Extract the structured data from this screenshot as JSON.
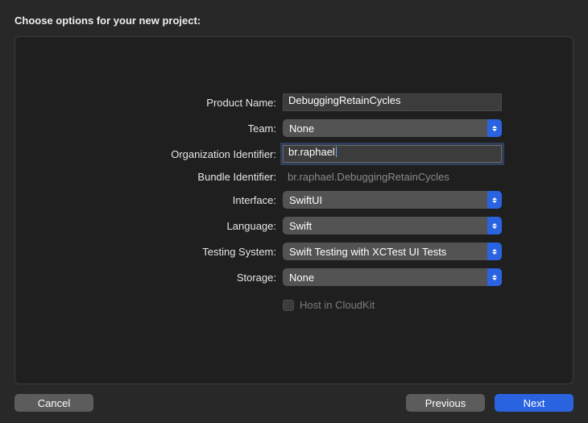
{
  "title": "Choose options for your new project:",
  "form": {
    "product_name": {
      "label": "Product Name:",
      "value": "DebuggingRetainCycles"
    },
    "team": {
      "label": "Team:",
      "value": "None"
    },
    "org_identifier": {
      "label": "Organization Identifier:",
      "value": "br.raphael"
    },
    "bundle_identifier": {
      "label": "Bundle Identifier:",
      "value": "br.raphael.DebuggingRetainCycles"
    },
    "interface": {
      "label": "Interface:",
      "value": "SwiftUI"
    },
    "language": {
      "label": "Language:",
      "value": "Swift"
    },
    "testing_system": {
      "label": "Testing System:",
      "value": "Swift Testing with XCTest UI Tests"
    },
    "storage": {
      "label": "Storage:",
      "value": "None"
    },
    "cloudkit": {
      "label": "Host in CloudKit",
      "checked": false
    }
  },
  "buttons": {
    "cancel": "Cancel",
    "previous": "Previous",
    "next": "Next"
  }
}
